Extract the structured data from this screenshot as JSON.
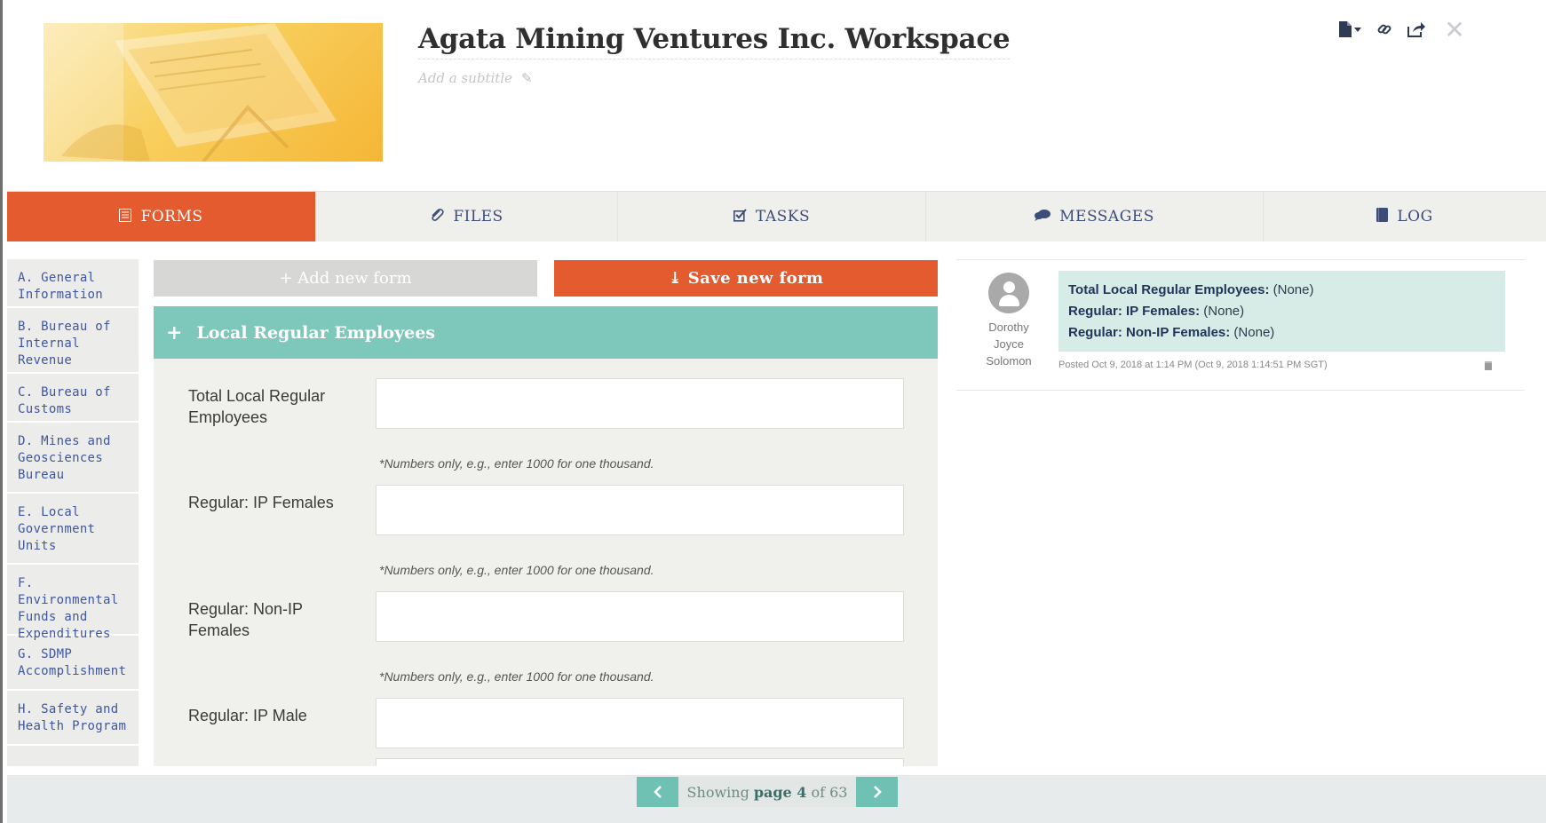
{
  "workspace": {
    "title": "Agata Mining Ventures Inc. Workspace",
    "subtitle_placeholder": "Add a subtitle"
  },
  "toolbar": {
    "icons": [
      "document-icon",
      "dropdown-caret-icon",
      "link-icon",
      "share-icon",
      "close-icon"
    ]
  },
  "tabs": [
    {
      "label": "FORMS",
      "icon": "form-list-icon",
      "active": true
    },
    {
      "label": "FILES",
      "icon": "paperclip-icon",
      "active": false
    },
    {
      "label": "TASKS",
      "icon": "checkbox-icon",
      "active": false
    },
    {
      "label": "MESSAGES",
      "icon": "chat-icon",
      "active": false
    },
    {
      "label": "LOG",
      "icon": "book-icon",
      "active": false
    }
  ],
  "sidebar": {
    "items": [
      "A. General Information",
      "B. Bureau of Internal Revenue",
      "C. Bureau of Customs",
      "D. Mines and Geosciences Bureau",
      "E. Local Government Units",
      "F. Environmental Funds and Expenditures",
      "G. SDMP Accomplishment",
      "H. Safety and Health Program"
    ]
  },
  "form": {
    "add_label": "+ Add new form",
    "save_label": "⤓ Save new form",
    "section_title": "Local Regular Employees",
    "fields": [
      {
        "label": "Total Local Regular Employees",
        "value": "",
        "hint": "*Numbers only, e.g., enter 1000 for one thousand."
      },
      {
        "label": "Regular: IP Females",
        "value": "",
        "hint": "*Numbers only, e.g., enter 1000 for one thousand."
      },
      {
        "label": "Regular: Non-IP Females",
        "value": "",
        "hint": "*Numbers only, e.g., enter 1000 for one thousand."
      },
      {
        "label": "Regular: IP Male",
        "value": "",
        "hint": ""
      }
    ]
  },
  "comment": {
    "author_lines": [
      "Dorothy",
      "Joyce",
      "Solomon"
    ],
    "lines": [
      {
        "key": "Total Local Regular Employees:",
        "value": " (None)"
      },
      {
        "key": "Regular: IP Females:",
        "value": " (None)"
      },
      {
        "key": "Regular: Non-IP Females:",
        "value": " (None)"
      }
    ],
    "posted": "Posted Oct 9, 2018 at 1:14 PM (Oct 9, 2018 1:14:51 PM SGT)"
  },
  "pagination": {
    "prefix": "Showing",
    "current": "page 4",
    "suffix": "of 63"
  },
  "colors": {
    "accent_orange": "#e45b30",
    "teal": "#7dc7bb",
    "nav_blue": "#3d4d7a"
  }
}
